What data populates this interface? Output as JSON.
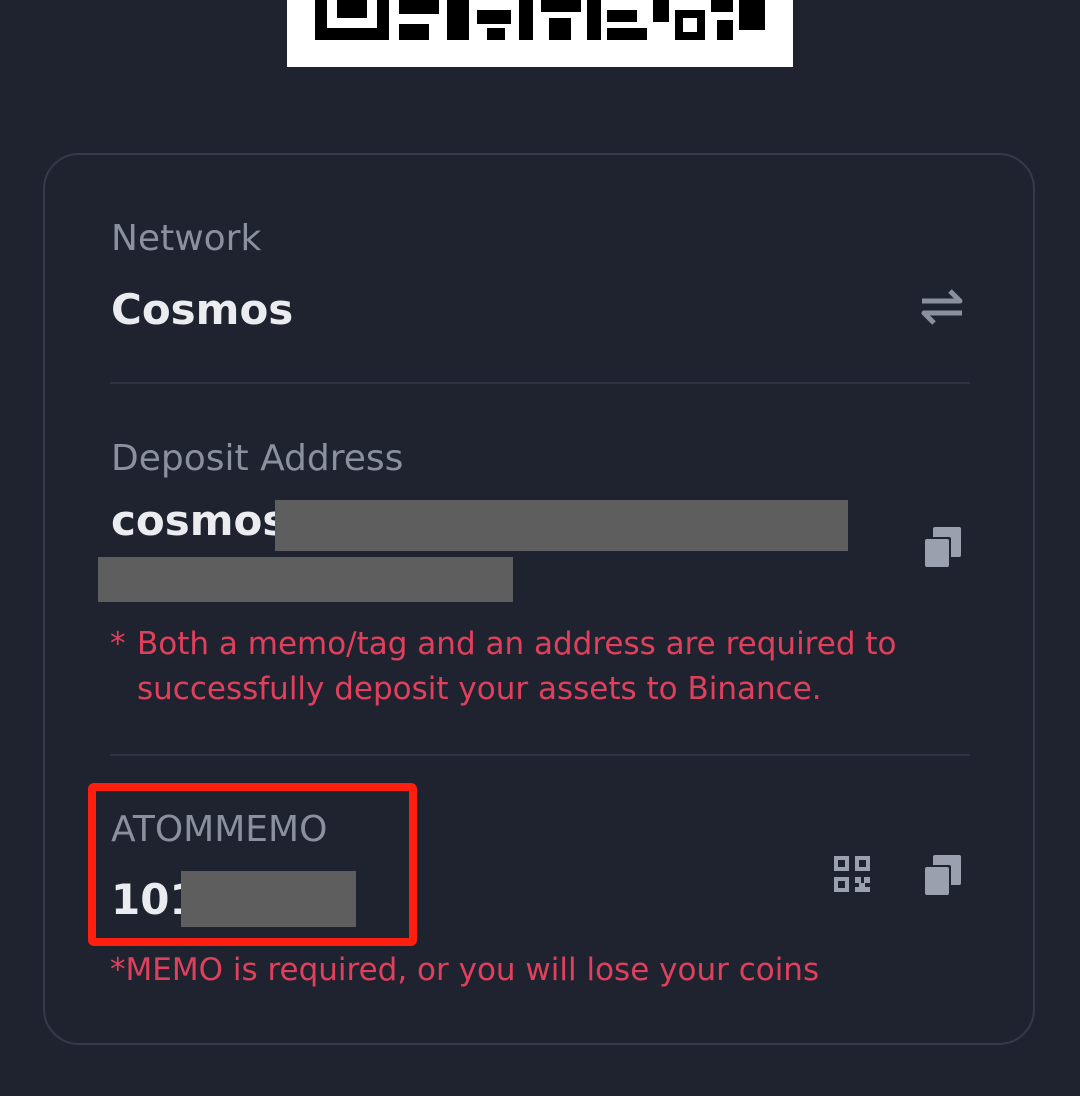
{
  "network": {
    "label": "Network",
    "value": "Cosmos",
    "switch_icon": "swap-arrows-icon"
  },
  "deposit": {
    "label": "Deposit Address",
    "address_visible": "cosmos1",
    "copy_icon": "copy-icon",
    "warning_star": "*",
    "warning_line1": "Both a memo/tag and an address are required to",
    "warning_line2": "successfully deposit your assets to Binance."
  },
  "memo": {
    "label": "ATOMMEMO",
    "value_visible": "101",
    "qr_icon": "qr-code-icon",
    "copy_icon": "copy-icon",
    "warning": "*MEMO is required, or you will lose your coins"
  },
  "colors": {
    "background": "#1f2330",
    "primary_text": "#eaecef",
    "secondary_text": "#8a909e",
    "warning": "#e0405c",
    "highlight": "#ff1f0f"
  }
}
